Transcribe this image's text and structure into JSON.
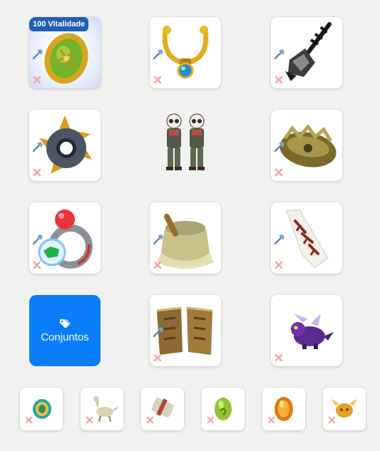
{
  "slots": {
    "amulet_badge": "100 Vitalidade",
    "amulet": {
      "icon": "amulet-dofus-icon"
    },
    "necklace": {
      "icon": "necklace-icon"
    },
    "weapon": {
      "icon": "hammer-weapon-icon"
    },
    "ring_left": {
      "icon": "spiked-ring-icon"
    },
    "shield": {
      "icon": "shield-icon"
    },
    "ring_right": {
      "icon": "gem-ring-icon"
    },
    "hat": {
      "icon": "hat-icon"
    },
    "cape": {
      "icon": "cape-icon"
    },
    "boots": {
      "icon": "boots-icon"
    },
    "pet": {
      "icon": "pet-dragon-icon"
    }
  },
  "character": {
    "icon": "character-portrait-icon"
  },
  "sets_button": {
    "label": "Conjuntos",
    "icon": "tag-icon"
  },
  "dofus_row": [
    {
      "icon": "dofus-turquoise-icon"
    },
    {
      "icon": "mount-icon"
    },
    {
      "icon": "scroll-icon"
    },
    {
      "icon": "dofus-emerald-icon"
    },
    {
      "icon": "dofus-amber-icon"
    },
    {
      "icon": "trophy-icon"
    }
  ],
  "colors": {
    "accent": "#0a7dfb",
    "badge": "#1f5fb3",
    "remove": "#f2a0a0",
    "mod": "#4d7eac"
  }
}
